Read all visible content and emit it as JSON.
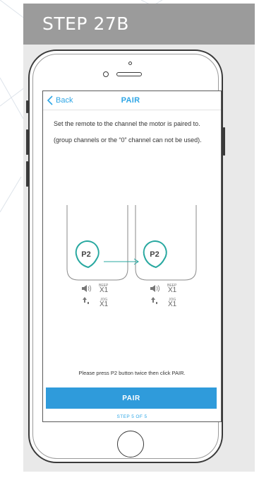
{
  "banner": {
    "title": "STEP 27B"
  },
  "nav": {
    "back_label": "Back",
    "title": "PAIR"
  },
  "instructions": {
    "line1": "Set the remote to the channel the motor is paired to.",
    "line2": "(group channels or the “0” channel can not be used)."
  },
  "remote_left": {
    "button": "P2",
    "beep_label": "BEEP",
    "beep_count": "X1",
    "jog_label": "JOG",
    "jog_count": "X1"
  },
  "remote_right": {
    "button": "P2",
    "beep_label": "BEEP",
    "beep_count": "X1",
    "jog_label": "JOG",
    "jog_count": "X1"
  },
  "prompt": "Please press P2 button twice then click PAIR.",
  "pair_button": "PAIR",
  "step_indicator": "STEP 5 OF 5",
  "colors": {
    "accent": "#2ea6e6",
    "button": "#2f9bdb",
    "banner": "#9b9b9b",
    "card": "#e9e9e9"
  },
  "icons": [
    "chevron-left-icon",
    "speaker-icon",
    "up-down-arrows-icon",
    "right-arrow-icon"
  ]
}
